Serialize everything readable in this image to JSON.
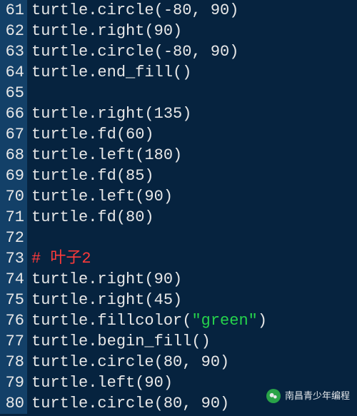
{
  "lines": [
    {
      "num": 61,
      "tokens": [
        {
          "cls": "tok-default",
          "text": "turtle.circle(-80, 90)"
        }
      ]
    },
    {
      "num": 62,
      "tokens": [
        {
          "cls": "tok-default",
          "text": "turtle.right(90)"
        }
      ]
    },
    {
      "num": 63,
      "tokens": [
        {
          "cls": "tok-default",
          "text": "turtle.circle(-80, 90)"
        }
      ]
    },
    {
      "num": 64,
      "tokens": [
        {
          "cls": "tok-default",
          "text": "turtle.end_fill()"
        }
      ]
    },
    {
      "num": 65,
      "tokens": [
        {
          "cls": "tok-default",
          "text": ""
        }
      ]
    },
    {
      "num": 66,
      "tokens": [
        {
          "cls": "tok-default",
          "text": "turtle.right(135)"
        }
      ]
    },
    {
      "num": 67,
      "tokens": [
        {
          "cls": "tok-default",
          "text": "turtle.fd(60)"
        }
      ]
    },
    {
      "num": 68,
      "tokens": [
        {
          "cls": "tok-default",
          "text": "turtle.left(180)"
        }
      ]
    },
    {
      "num": 69,
      "tokens": [
        {
          "cls": "tok-default",
          "text": "turtle.fd(85)"
        }
      ]
    },
    {
      "num": 70,
      "tokens": [
        {
          "cls": "tok-default",
          "text": "turtle.left(90)"
        }
      ]
    },
    {
      "num": 71,
      "tokens": [
        {
          "cls": "tok-default",
          "text": "turtle.fd(80)"
        }
      ]
    },
    {
      "num": 72,
      "tokens": [
        {
          "cls": "tok-default",
          "text": ""
        }
      ]
    },
    {
      "num": 73,
      "tokens": [
        {
          "cls": "tok-comment",
          "text": "# 叶子2"
        }
      ]
    },
    {
      "num": 74,
      "tokens": [
        {
          "cls": "tok-default",
          "text": "turtle.right(90)"
        }
      ]
    },
    {
      "num": 75,
      "tokens": [
        {
          "cls": "tok-default",
          "text": "turtle.right(45)"
        }
      ]
    },
    {
      "num": 76,
      "tokens": [
        {
          "cls": "tok-default",
          "text": "turtle.fillcolor("
        },
        {
          "cls": "tok-string",
          "text": "\"green\""
        },
        {
          "cls": "tok-default",
          "text": ")"
        }
      ]
    },
    {
      "num": 77,
      "tokens": [
        {
          "cls": "tok-default",
          "text": "turtle.begin_fill()"
        }
      ]
    },
    {
      "num": 78,
      "tokens": [
        {
          "cls": "tok-default",
          "text": "turtle.circle(80, 90)"
        }
      ]
    },
    {
      "num": 79,
      "tokens": [
        {
          "cls": "tok-default",
          "text": "turtle.left(90)"
        }
      ]
    },
    {
      "num": 80,
      "tokens": [
        {
          "cls": "tok-default",
          "text": "turtle.circle(80, 90)"
        }
      ]
    }
  ],
  "watermark": {
    "label": "南昌青少年编程"
  }
}
